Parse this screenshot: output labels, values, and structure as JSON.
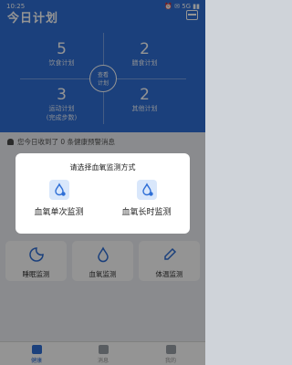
{
  "status_bar": {
    "time": "10:25",
    "icons": "⏰ ✉ 5G ▮▮"
  },
  "header": {
    "title": "今日计划"
  },
  "plan_grid": {
    "diet": {
      "value": "5",
      "label": "饮食计划"
    },
    "exercise": {
      "value": "2",
      "label": "膳食计划"
    },
    "sport": {
      "value": "3",
      "label": "运动计划\n(完成步数)"
    },
    "other": {
      "value": "2",
      "label": "其他计划"
    },
    "center_button": "查看\n计划"
  },
  "notice": {
    "text": "您今日收到了 0 条健康预警消息"
  },
  "cards": [
    {
      "label": "睡眠监测",
      "icon": "sleep-icon"
    },
    {
      "label": "血氧监测",
      "icon": "blood-oxygen-icon"
    },
    {
      "label": "体温监测",
      "icon": "thermometer-icon"
    }
  ],
  "tabs": [
    {
      "label": "健康",
      "active": true
    },
    {
      "label": "消息",
      "active": false
    },
    {
      "label": "我的",
      "active": false
    }
  ],
  "dialog": {
    "title": "请选择血氧监测方式",
    "options": [
      {
        "label": "血氧单次监测",
        "icon": "blood-oxygen-single-icon"
      },
      {
        "label": "血氧长时监测",
        "icon": "blood-oxygen-long-icon"
      }
    ]
  },
  "colors": {
    "accent": "#2f6fd6",
    "icon_bg": "#d9e7fb",
    "overlay": "rgba(0,0,0,0.42)"
  }
}
